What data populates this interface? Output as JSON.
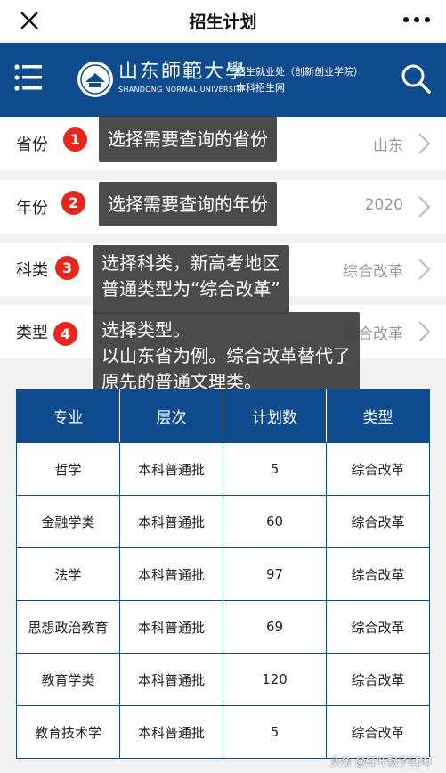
{
  "titlebar": {
    "title": "招生计划"
  },
  "banner": {
    "brand_cn": "山东師範大學",
    "brand_en": "SHANDONG NORMAL UNIVERSITY",
    "subtitle_line1": "招生就业处（创新创业学院）",
    "subtitle_line2": "本科招生网"
  },
  "filters": [
    {
      "label": "省份",
      "value": "山东",
      "badge": "1",
      "tip": "选择需要查询的省份"
    },
    {
      "label": "年份",
      "value": "2020",
      "badge": "2",
      "tip": "选择需要查询的年份"
    },
    {
      "label": "科类",
      "value": "综合改革",
      "badge": "3",
      "tip_line1": "选择科类，新高考地区",
      "tip_line2": "普通类型为“综合改革”"
    },
    {
      "label": "类型",
      "value": "综合改革",
      "badge": "4",
      "tip_line1": "选择类型。",
      "tip_line2": "以山东省为例。综合改革替代了",
      "tip_line3": "原先的普通文理类。"
    }
  ],
  "table": {
    "headers": [
      "专业",
      "层次",
      "计划数",
      "类型"
    ],
    "rows": [
      [
        "哲学",
        "本科普通批",
        "5",
        "综合改革"
      ],
      [
        "金融学类",
        "本科普通批",
        "60",
        "综合改革"
      ],
      [
        "法学",
        "本科普通批",
        "97",
        "综合改革"
      ],
      [
        "思想政治教育",
        "本科普通批",
        "69",
        "综合改革"
      ],
      [
        "教育学类",
        "本科普通批",
        "120",
        "综合改革"
      ],
      [
        "教育技术学",
        "本科普通批",
        "5",
        "综合改革"
      ]
    ]
  },
  "watermark": "头条 @红叶飘子EDU",
  "colors": {
    "banner": "#0f4c8f",
    "badge": "#e8261c"
  }
}
